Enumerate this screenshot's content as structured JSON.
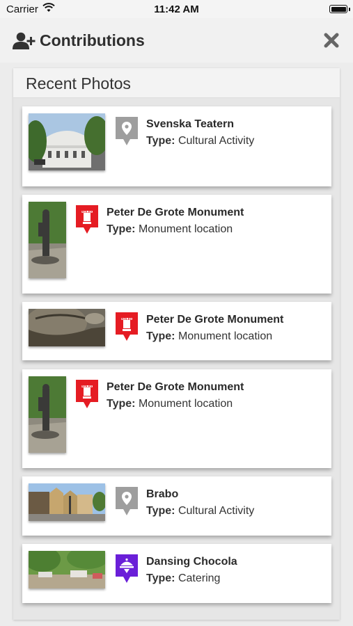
{
  "status_bar": {
    "carrier": "Carrier",
    "time": "11:42 AM"
  },
  "header": {
    "title": "Contributions",
    "icons": [
      "add-user-icon",
      "close-icon"
    ]
  },
  "panel": {
    "title": "Recent Photos"
  },
  "type_label": "Type:",
  "items": [
    {
      "name": "Svenska Teatern",
      "type": "Cultural Activity",
      "pin": "grey-location-pin-icon"
    },
    {
      "name": "Peter De Grote Monument",
      "type": "Monument location",
      "pin": "red-monument-pin-icon"
    },
    {
      "name": "Peter De Grote Monument",
      "type": "Monument location",
      "pin": "red-monument-pin-icon"
    },
    {
      "name": "Peter De Grote Monument",
      "type": "Monument location",
      "pin": "red-monument-pin-icon"
    },
    {
      "name": "Brabo",
      "type": "Cultural Activity",
      "pin": "grey-location-pin-icon"
    },
    {
      "name": "Dansing Chocola",
      "type": "Catering",
      "pin": "purple-catering-pin-icon"
    }
  ],
  "colors": {
    "monument_pin": "#e51c23",
    "cultural_pin": "#9e9e9e",
    "catering_pin": "#6a1fd8"
  }
}
